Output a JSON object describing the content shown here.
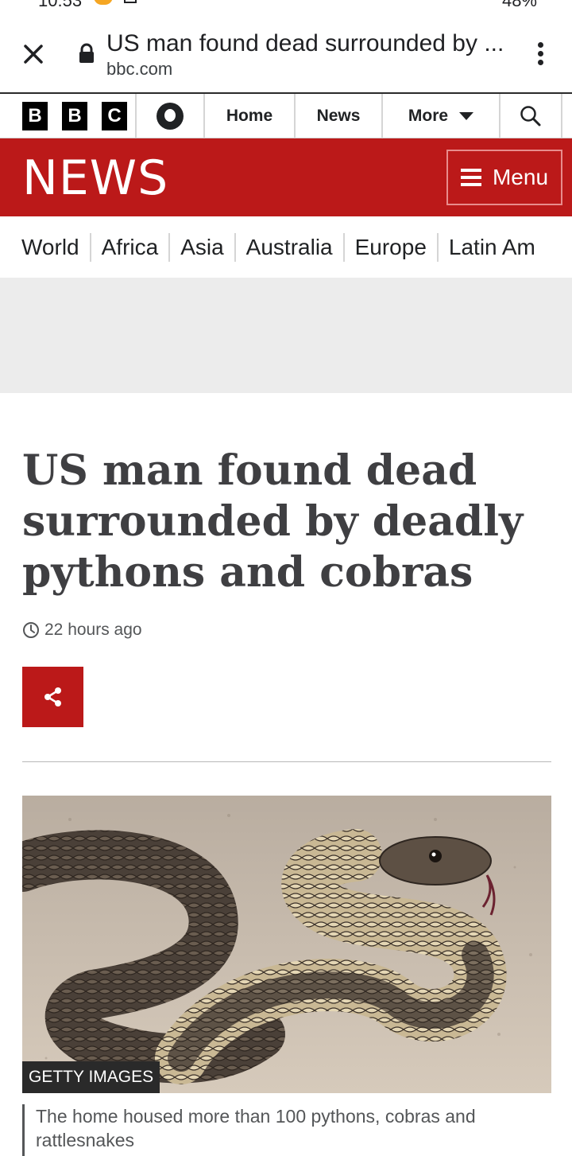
{
  "statusbar": {
    "time": "10:53",
    "battery": "48%"
  },
  "browser": {
    "page_title": "US man found dead surrounded by ...",
    "url": "bbc.com"
  },
  "bbc_nav": {
    "logo_letters": [
      "B",
      "B",
      "C"
    ],
    "home": "Home",
    "news": "News",
    "more": "More"
  },
  "banner": {
    "wordmark": "NEWS",
    "menu": "Menu",
    "color": "#bb1919"
  },
  "sections": [
    "World",
    "Africa",
    "Asia",
    "Australia",
    "Europe",
    "Latin Am"
  ],
  "article": {
    "headline": "US man found dead surrounded by deadly pythons and cobras",
    "timestamp": "22 hours ago",
    "image_credit": "GETTY IMAGES",
    "caption": "The home housed more than 100 pythons, cobras and rattlesnakes"
  }
}
